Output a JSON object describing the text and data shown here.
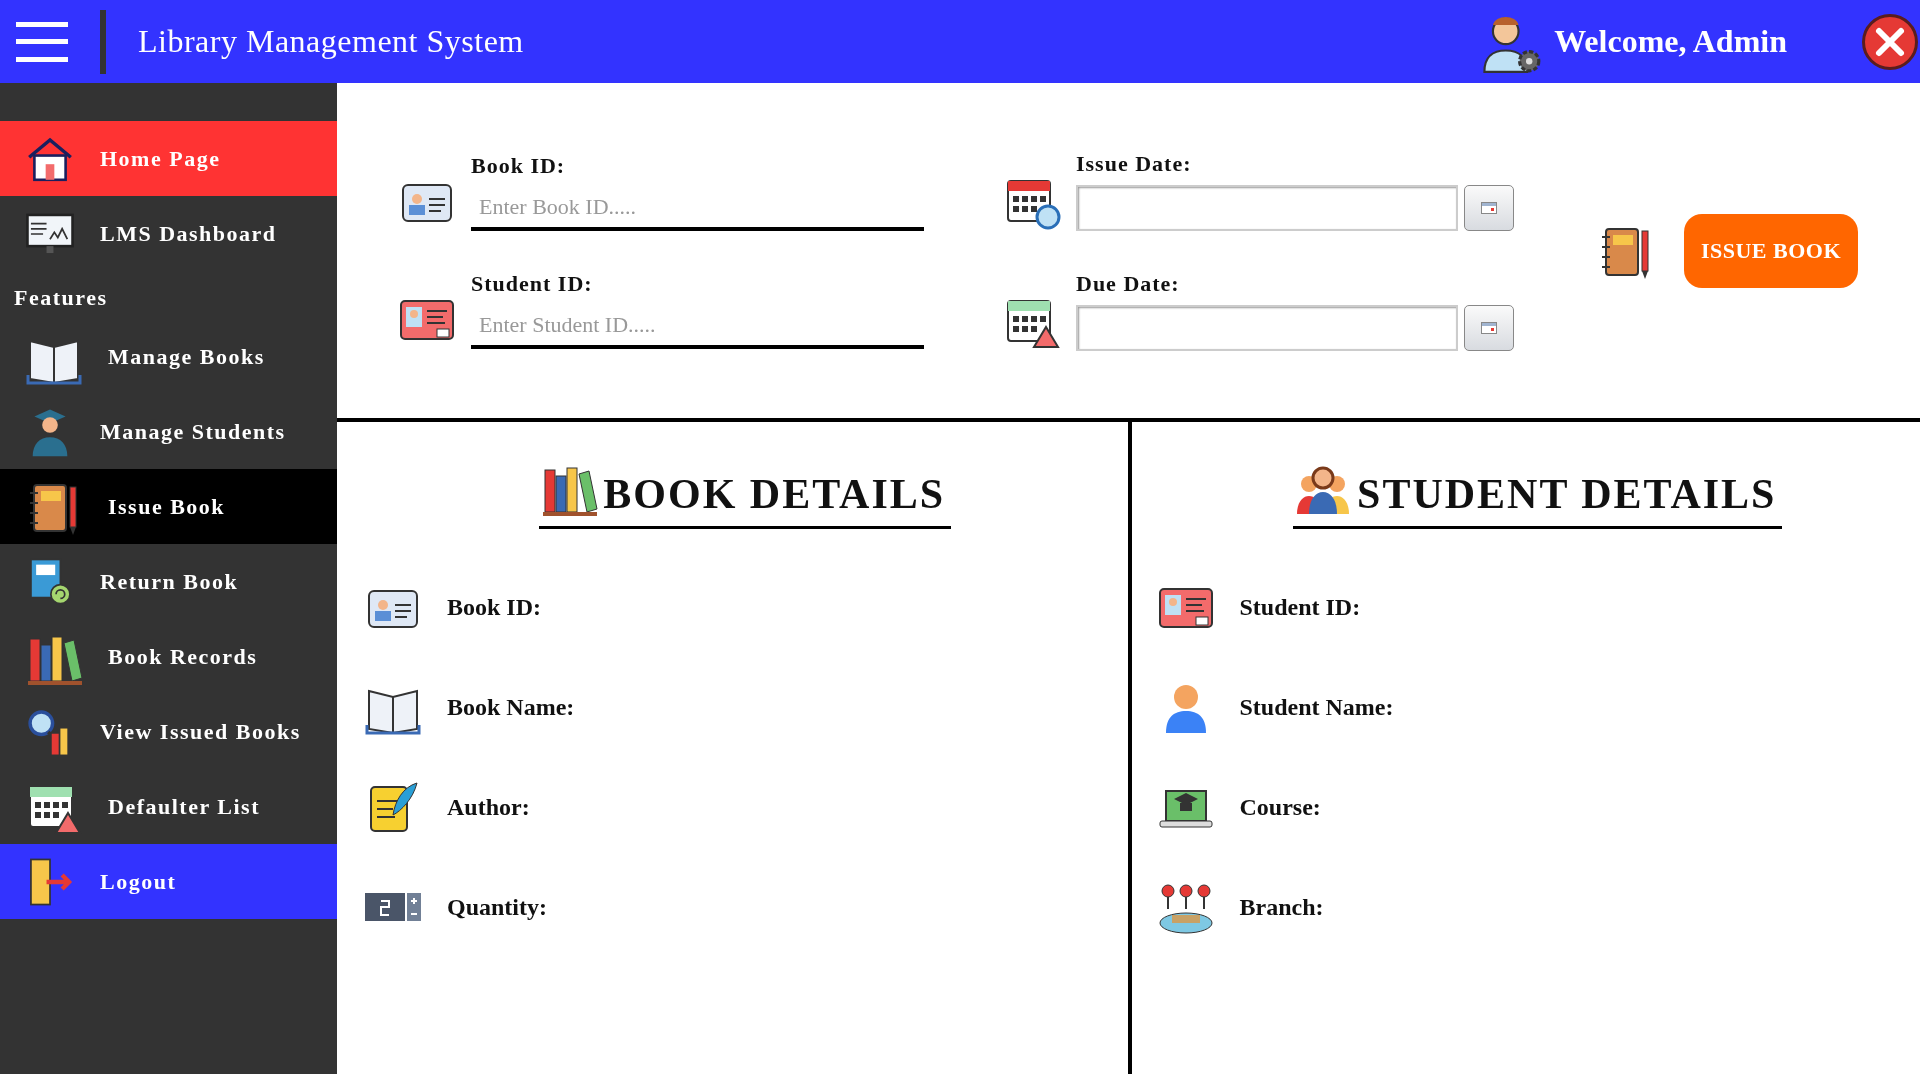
{
  "header": {
    "title": "Library Management System",
    "welcome": "Welcome, Admin"
  },
  "sidebar": {
    "items": [
      {
        "label": "Home Page",
        "color": "#ff3333",
        "selected": false
      },
      {
        "label": "LMS Dashboard",
        "color": "#333333",
        "selected": false
      },
      {
        "kind": "section",
        "label": "Features"
      },
      {
        "label": "Manage Books",
        "color": "#333333",
        "selected": false
      },
      {
        "label": "Manage Students",
        "color": "#333333",
        "selected": false
      },
      {
        "label": "Issue Book",
        "selected": true
      },
      {
        "label": "Return Book",
        "color": "#333333",
        "selected": false
      },
      {
        "label": "Book Records",
        "color": "#333333",
        "selected": false
      },
      {
        "label": "View Issued Books",
        "color": "#333333",
        "selected": false
      },
      {
        "label": "Defaulter List",
        "color": "#333333",
        "selected": false
      },
      {
        "label": "Logout",
        "color": "#3333ff",
        "selected": false
      }
    ]
  },
  "form": {
    "book_id": {
      "label": "Book ID:",
      "placeholder": "Enter Book ID....."
    },
    "student_id": {
      "label": "Student ID:",
      "placeholder": "Enter Student ID....."
    },
    "issue_date": {
      "label": "Issue Date:"
    },
    "due_date": {
      "label": "Due Date:"
    },
    "button": "ISSUE BOOK"
  },
  "book_details": {
    "title": "BOOK DETAILS",
    "fields": [
      "Book ID:",
      "Book Name:",
      "Author:",
      "Quantity:"
    ]
  },
  "student_details": {
    "title": "STUDENT DETAILS",
    "fields": [
      "Student ID:",
      "Student Name:",
      "Course:",
      "Branch:"
    ]
  }
}
